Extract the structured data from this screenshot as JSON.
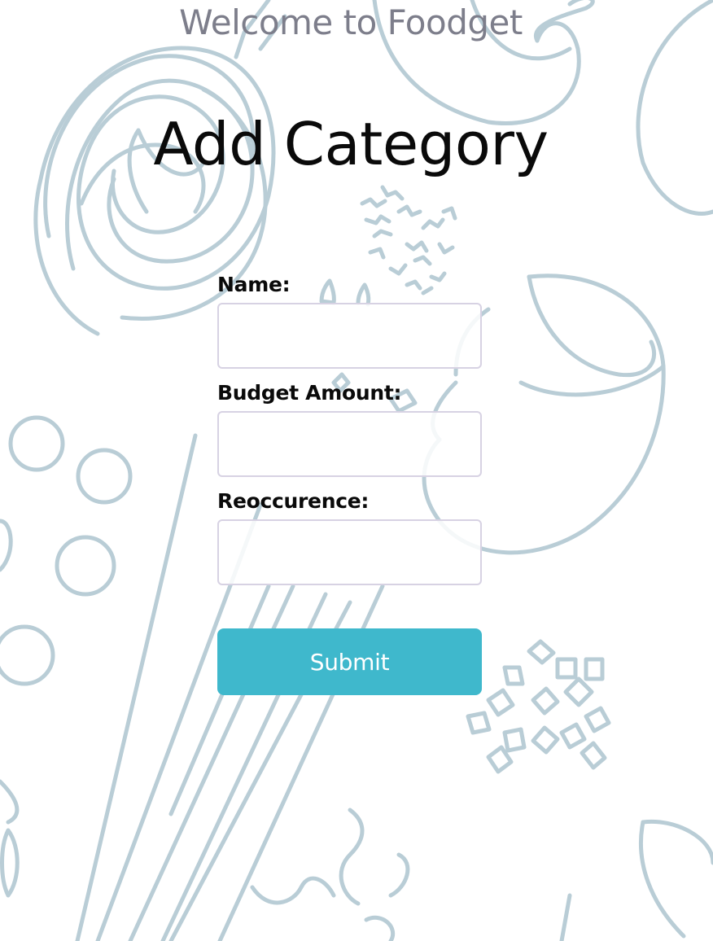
{
  "header": {
    "welcome_text": "Welcome to Foodget",
    "title": "Add Category"
  },
  "form": {
    "name_label": "Name:",
    "name_value": "",
    "budget_label": "Budget Amount:",
    "budget_value": "",
    "reoccurence_label": "Reoccurence:",
    "reoccurence_value": "",
    "submit_label": "Submit"
  },
  "colors": {
    "accent": "#3fb8cc",
    "doodle": "#b9cdd6",
    "welcome_text": "#7d7e8b"
  }
}
